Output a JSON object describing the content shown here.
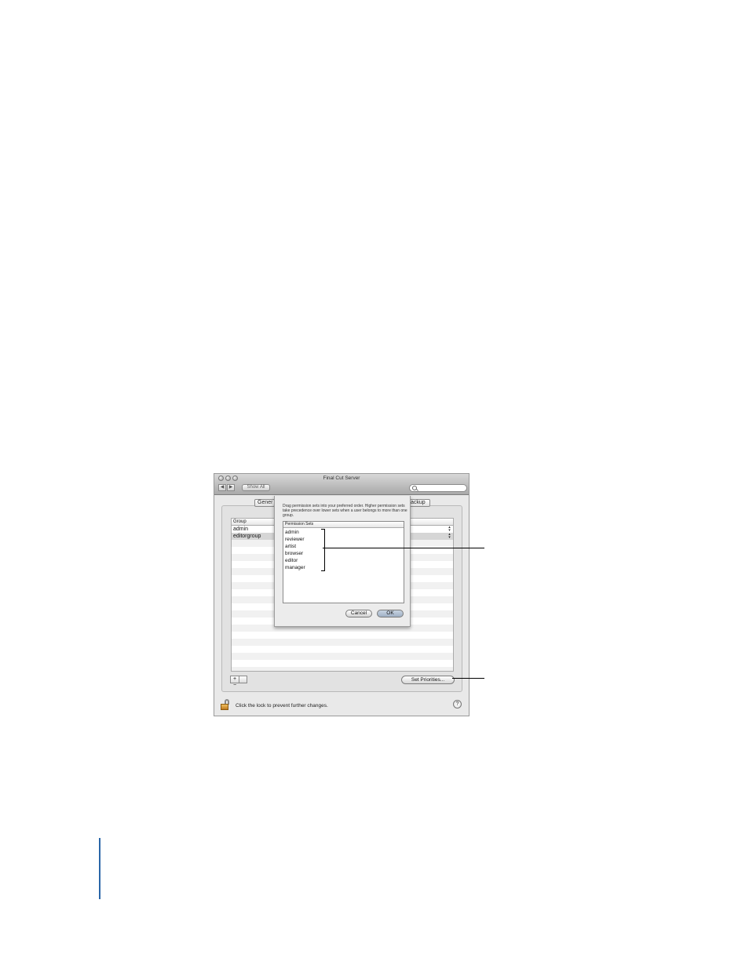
{
  "window": {
    "title": "Final Cut Server",
    "back_label": "◀",
    "forward_label": "▶",
    "show_all_label": "Show All",
    "search_placeholder": ""
  },
  "tabs": [
    {
      "label": "Gener"
    },
    {
      "label": "ackup"
    }
  ],
  "table": {
    "column_header": "Group",
    "rows": [
      {
        "label": "admin",
        "stepper": "▲▼"
      },
      {
        "label": "editorgroup",
        "stepper": "▲▼"
      }
    ]
  },
  "footer": {
    "add_label": "+",
    "add_menu_label": "▾",
    "remove_label": "−",
    "set_priorities_label": "Set Priorities...",
    "lock_text": "Click the lock to prevent further changes.",
    "help_label": "?"
  },
  "sheet": {
    "instructions": "Drag permission sets into your preferred order. Higher permission sets take precedence over lower sets when a user belongs to more than one group.",
    "list_header": "Permission Sets",
    "items": [
      "admin",
      "reviewer",
      "artist",
      "browser",
      "editor",
      "manager"
    ],
    "cancel_label": "Cancel",
    "ok_label": "OK"
  }
}
